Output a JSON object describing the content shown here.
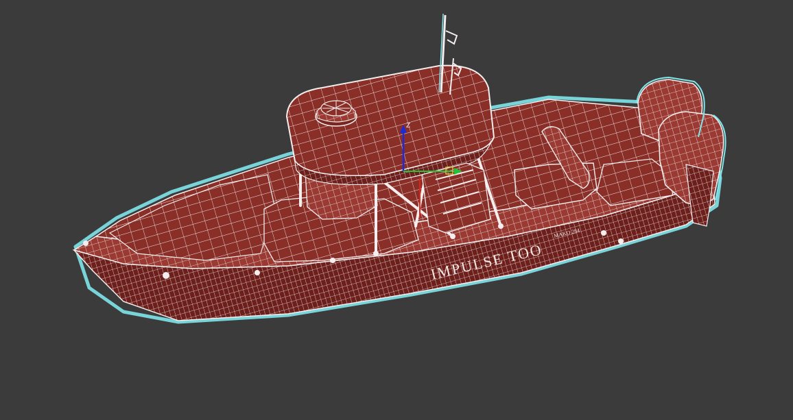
{
  "viewport": {
    "mode": "wireframe-shaded",
    "background_color": "#3b3b3b",
    "mesh_color": "#8a2e28",
    "wire_color": "#f4eeee",
    "selection_outline_color": "#7fe6ea"
  },
  "model": {
    "hull_name": "IMPULSE TOO",
    "hull_badge": "MAKO 284"
  },
  "gizmo": {
    "z_label": "Z",
    "z_axis_color": "#1c2bd8",
    "x_axis_color": "#d8261c",
    "y_axis_color": "#22c43a"
  }
}
